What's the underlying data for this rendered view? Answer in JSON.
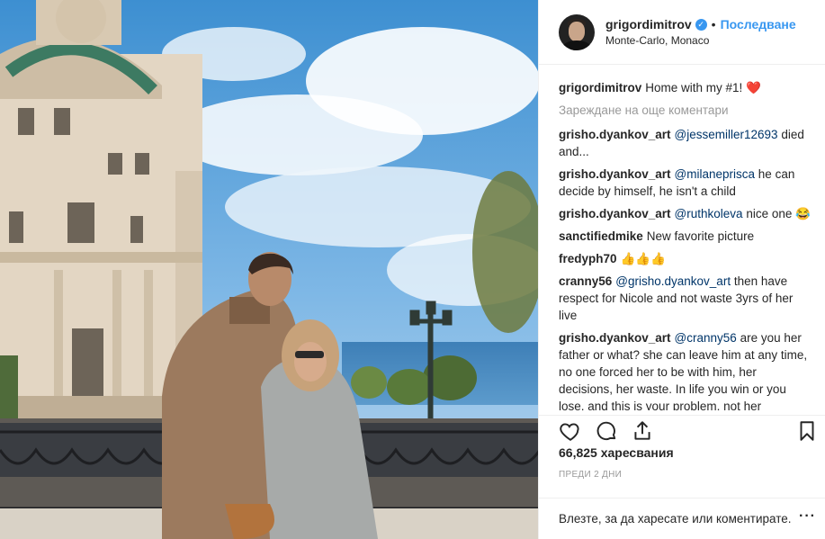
{
  "header": {
    "username": "grigordimitrov",
    "separator": "•",
    "follow_label": "Последване",
    "location": "Monte-Carlo, Monaco"
  },
  "caption": {
    "username": "grigordimitrov",
    "text": "Home with my #1!",
    "emoji": "❤️"
  },
  "load_more": "Зареждане на още коментари",
  "comments": [
    {
      "username": "grisho.dyankov_art",
      "mention": "@jessemiller12693",
      "text": "died and..."
    },
    {
      "username": "grisho.dyankov_art",
      "mention": "@milaneprisca",
      "text": "he can decide by himself, he isn't a child"
    },
    {
      "username": "grisho.dyankov_art",
      "mention": "@ruthkoleva",
      "text": "nice one 😂"
    },
    {
      "username": "sanctifiedmike",
      "mention": "",
      "text": "New favorite picture"
    },
    {
      "username": "fredyph70",
      "mention": "",
      "text": "👍👍👍"
    },
    {
      "username": "cranny56",
      "mention": "@grisho.dyankov_art",
      "text": "then have respect for Nicole and not waste 3yrs of her live"
    },
    {
      "username": "grisho.dyankov_art",
      "mention": "@cranny56",
      "text": "are you her father or what? she can leave him at any time, no one forced her to be with him, her decisions, her waste. In life you win or you lose, and this is your problem, not her"
    }
  ],
  "likes": "66,825 харесвания",
  "timestamp": "ПРЕДИ 2 ДНИ",
  "footer": {
    "login_link": "Влезте",
    "text": ", за да харесате или коментирате."
  },
  "icons": {
    "verified": "verified-badge-icon",
    "like": "heart-icon",
    "comment": "comment-bubble-icon",
    "share": "share-icon",
    "save": "bookmark-icon",
    "more": "more-options-icon"
  },
  "colors": {
    "link": "#3897f0",
    "mention": "#003569",
    "muted": "#999999",
    "heart": "#ed4956"
  }
}
